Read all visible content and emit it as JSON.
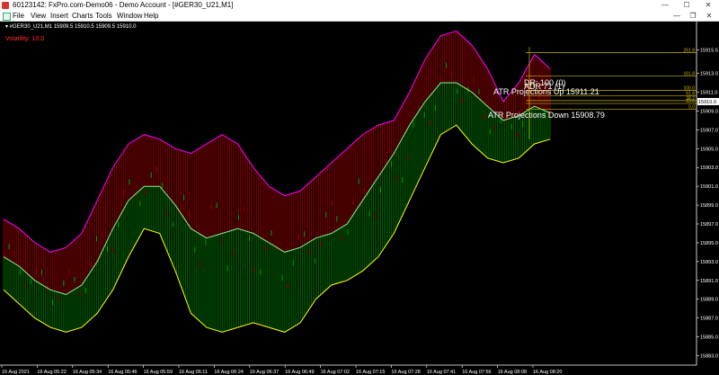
{
  "window": {
    "title": "60123142: FxPro.com-Demo06 - Demo Account - [#GER30_U21,M1]",
    "controls": [
      "—",
      "☐",
      "✕"
    ],
    "mdi_controls": [
      "—",
      "❐",
      "✕"
    ]
  },
  "menu": {
    "items": [
      "File",
      "View",
      "Insert",
      "Charts",
      "Tools",
      "Window",
      "Help"
    ]
  },
  "chart": {
    "header": "▾ #GER30_U21,M1  15909.5 15910.5 15909.5 15910.0",
    "volatility_label": "Volatility: 10.0",
    "annotations": {
      "dr": "DR: 100 (0)",
      "adr": "ADR 71 (1)",
      "atr_up": "ATR Projections Up 15911.21",
      "atr_down": "ATR Projections Down 15908.79"
    },
    "fib_levels": [
      {
        "label": "261.8",
        "price": 15915.2
      },
      {
        "label": "161.8",
        "price": 15912.7
      },
      {
        "label": "100.0",
        "price": 15911.2
      },
      {
        "label": "61.8",
        "price": 15910.6
      },
      {
        "label": "38.2",
        "price": 15910.1
      },
      {
        "label": "23.6",
        "price": 15909.8
      },
      {
        "label": "0.0",
        "price": 15909.2
      }
    ],
    "current_price": "15910.0",
    "colors": {
      "background": "#000000",
      "bear_fill": "#8b0000",
      "bull_fill": "#006400",
      "upper_band": "#ff00ff",
      "middle_band": "#90ee90",
      "lower_band": "#ffff00",
      "fib": "#c8b400",
      "volatility": "#ff3030",
      "text": "#ffffff",
      "price_badge": "#ffffff"
    }
  },
  "chart_data": {
    "type": "line",
    "title": "#GER30_U21,M1",
    "y_axis_ticks": [
      15915.5,
      15913.0,
      15911.0,
      15909.0,
      15907.0,
      15905.0,
      15903.0,
      15901.0,
      15899.0,
      15897.0,
      15895.0,
      15893.0,
      15891.0,
      15889.0,
      15887.0,
      15885.0,
      15883.0
    ],
    "x_axis_ticks": [
      "16 Aug 2021",
      "16 Aug 05:22",
      "16 Aug 05:34",
      "16 Aug 05:46",
      "16 Aug 05:59",
      "16 Aug 06:11",
      "16 Aug 06:24",
      "16 Aug 06:37",
      "16 Aug 06:49",
      "16 Aug 07:02",
      "16 Aug 07:15",
      "16 Aug 07:28",
      "16 Aug 07:41",
      "16 Aug 07:56",
      "16 Aug 08:08",
      "16 Aug 08:20"
    ],
    "ylim": [
      15882.0,
      15918.5
    ],
    "series": [
      {
        "name": "upper",
        "values": [
          15897.5,
          15896.5,
          15895.0,
          15894.0,
          15894.5,
          15896.0,
          15899.5,
          15903.0,
          15905.5,
          15906.5,
          15906.0,
          15905.0,
          15904.5,
          15905.5,
          15906.5,
          15905.5,
          15903.0,
          15901.0,
          15900.0,
          15900.5,
          15902.0,
          15903.5,
          15905.0,
          15906.5,
          15907.5,
          15908.0,
          15911.0,
          15914.5,
          15917.0,
          15917.5,
          15916.0,
          15913.5,
          15910.0,
          15912.0,
          15915.0,
          15913.5
        ]
      },
      {
        "name": "middle",
        "values": [
          15893.5,
          15892.5,
          15891.0,
          15890.0,
          15889.5,
          15890.5,
          15893.0,
          15896.5,
          15899.5,
          15901.0,
          15901.0,
          15899.0,
          15896.5,
          15895.5,
          15896.0,
          15896.5,
          15896.0,
          15895.0,
          15894.0,
          15894.5,
          15895.5,
          15896.0,
          15897.0,
          15899.5,
          15902.0,
          15904.5,
          15907.5,
          15910.0,
          15912.0,
          15912.0,
          15911.0,
          15909.5,
          15908.0,
          15908.5,
          15909.5,
          15908.8
        ]
      },
      {
        "name": "lower",
        "values": [
          15890.0,
          15888.5,
          15887.0,
          15886.0,
          15885.5,
          15886.0,
          15887.5,
          15890.0,
          15893.5,
          15896.5,
          15896.0,
          15892.0,
          15887.5,
          15886.0,
          15885.5,
          15886.0,
          15886.5,
          15886.0,
          15885.5,
          15886.5,
          15889.0,
          15890.5,
          15891.0,
          15892.0,
          15893.5,
          15896.0,
          15899.5,
          15903.0,
          15906.5,
          15907.5,
          15905.5,
          15904.0,
          15903.5,
          15904.0,
          15905.5,
          15906.0
        ]
      }
    ]
  }
}
